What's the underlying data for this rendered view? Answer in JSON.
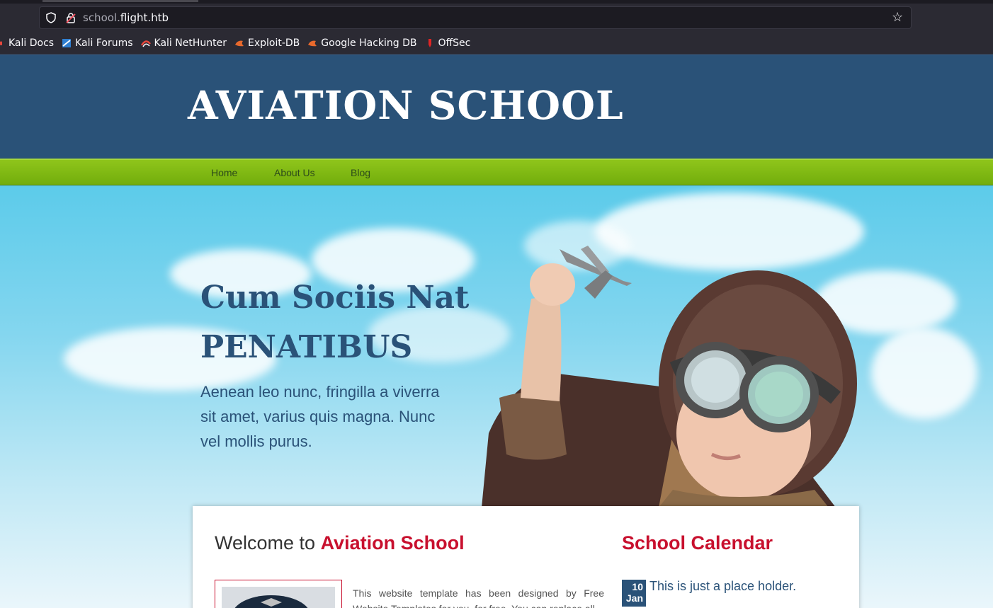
{
  "browser": {
    "url_subdomain": "school.",
    "url_domain": "flight.htb",
    "bookmarks": [
      {
        "label": "Kali Docs",
        "icon": "kali-dragon-icon"
      },
      {
        "label": "Kali Forums",
        "icon": "kali-forums-icon"
      },
      {
        "label": "Kali NetHunter",
        "icon": "kali-nethunter-icon"
      },
      {
        "label": "Exploit-DB",
        "icon": "exploit-db-icon"
      },
      {
        "label": "Google Hacking DB",
        "icon": "ghdb-icon"
      },
      {
        "label": "OffSec",
        "icon": "offsec-icon"
      }
    ]
  },
  "site": {
    "logo": "AVIATION SCHOOL",
    "nav": [
      "Home",
      "About Us",
      "Blog"
    ],
    "hero": {
      "title_line1": "Cum Sociis Nat",
      "title_line2": "PENATIBUS",
      "text": "Aenean leo nunc, fringilla a viverra sit amet, varius quis magna. Nunc vel mollis purus."
    },
    "welcome": {
      "prefix": "Welcome to ",
      "highlight": "Aviation School",
      "body": "This website template has been designed by Free Website Templates for you, for free. You can replace all"
    },
    "calendar": {
      "title": "School Calendar",
      "day": "10",
      "month": "Jan",
      "text": "This is just a place holder."
    }
  },
  "colors": {
    "header_blue": "#2a5278",
    "nav_green": "#80bb14",
    "accent_red": "#c8102e"
  }
}
